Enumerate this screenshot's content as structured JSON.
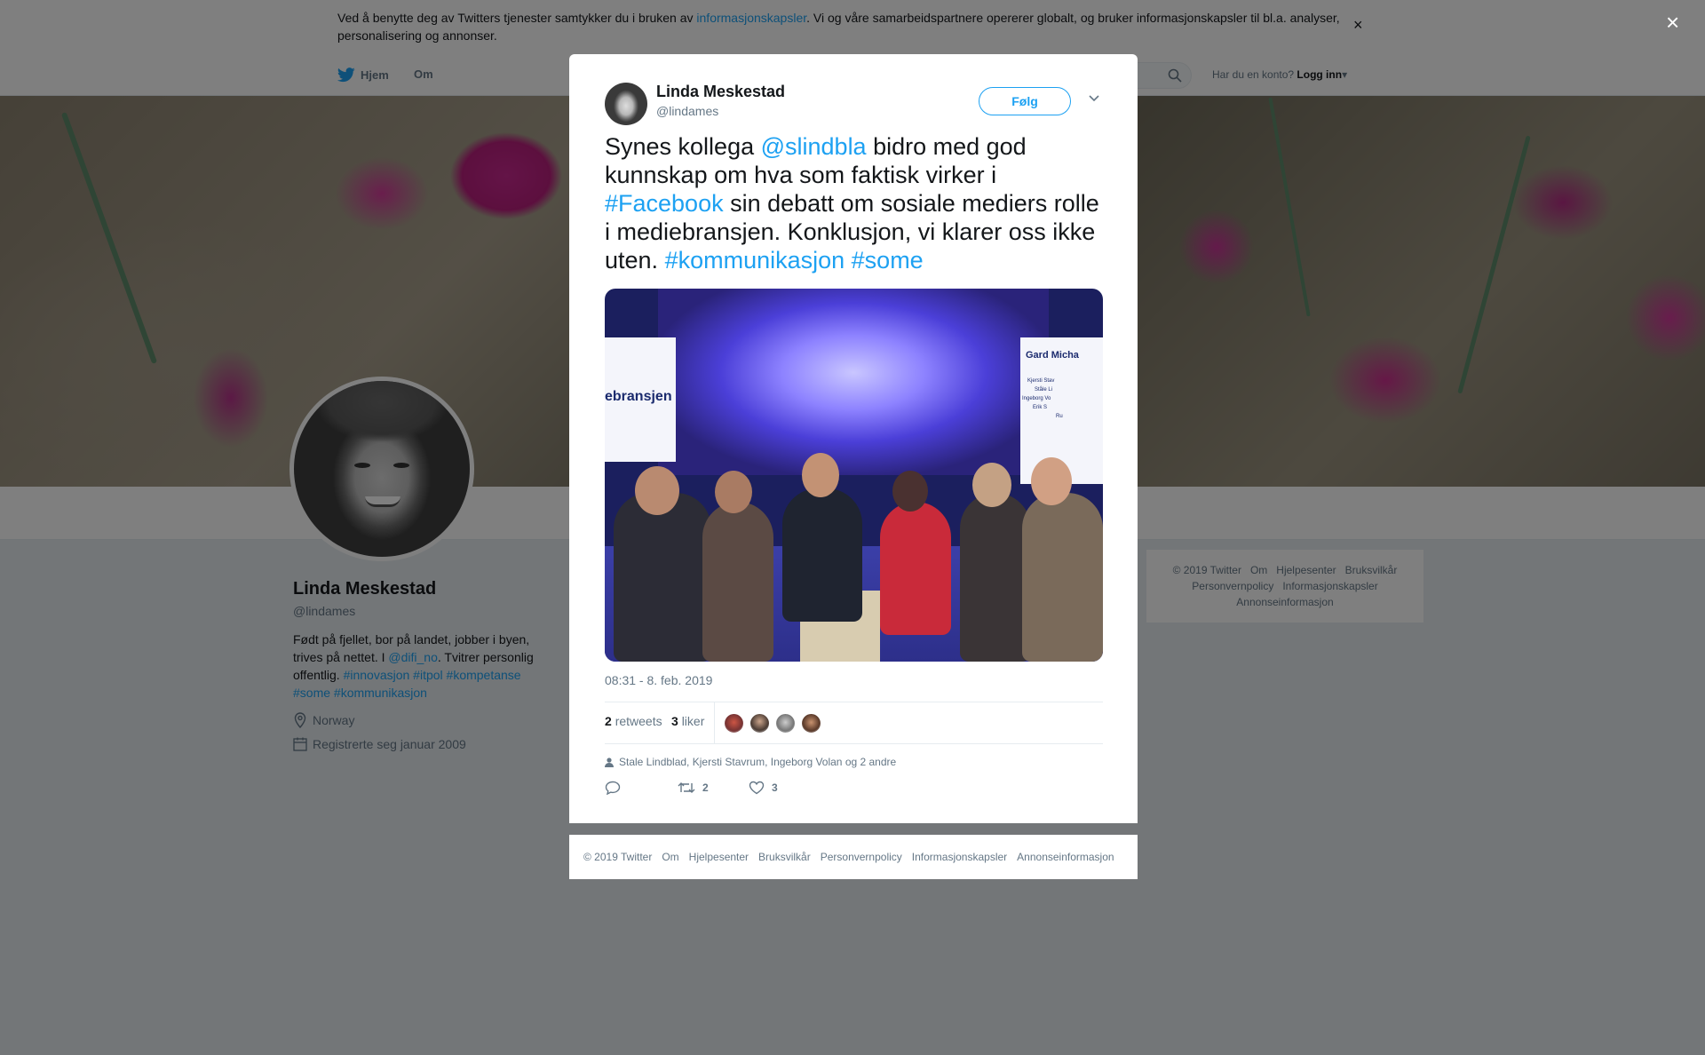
{
  "cookie": {
    "text_before": "Ved å benytte deg av Twitters tjenester samtykker du i bruken av ",
    "link": "informasjonskapsler",
    "text_after": ". Vi og våre samarbeidspartnere opererer globalt, og bruker informasjonskapsler til bl.a. analyser, personalisering og annonser.",
    "close": "×"
  },
  "topnav": {
    "home": "Hjem",
    "about": "Om",
    "account_prompt": "Har du en konto?",
    "login": "Logg inn"
  },
  "profile": {
    "name": "Linda Meskestad",
    "handle": "@lindames",
    "bio_1": "Født på fjellet, bor på landet, jobber i byen, trives på nettet. I ",
    "bio_mention": "@difi_no",
    "bio_2": ". Tvitrer personlig offentlig. ",
    "bio_tags": "#innovasjon #itpol #kompetanse #some #kommunikasjon",
    "location": "Norway",
    "joined": "Registrerte seg januar 2009"
  },
  "side_footer": {
    "items": [
      "© 2019 Twitter",
      "Om",
      "Hjelpesenter",
      "Bruksvilkår",
      "Personvernpolicy",
      "Informasjonskapsler",
      "Annonseinformasjon"
    ]
  },
  "modal": {
    "close": "×",
    "author_name": "Linda Meskestad",
    "author_handle": "@lindames",
    "follow": "Følg",
    "text_1": "Synes kollega ",
    "mention": "@slindbla",
    "text_2": " bidro med god kunnskap om hva som faktisk virker i ",
    "hashtag_facebook": "#Facebook",
    "text_3": " sin debatt om sosiale mediers rolle i mediebransjen. Konklusjon, vi klarer oss ikke uten. ",
    "hashtags_end": "#kommunikasjon #some",
    "photo": {
      "left_screen": "ebransjen",
      "right_title": "Gard Micha",
      "right_lines": [
        "Kjersti Stav",
        "Ståle Li",
        "Ingeborg Vo",
        "Erik S",
        "Ru"
      ]
    },
    "timestamp": "08:31 - 8. feb. 2019",
    "retweets_count": "2",
    "retweets_label": "retweets",
    "likes_count": "3",
    "likes_label": "liker",
    "likers_text": "Stale Lindblad, Kjersti Stavrum, Ingeborg Volan og 2 andre",
    "action_retweet_count": "2",
    "action_like_count": "3"
  },
  "modal_footer": {
    "items": [
      "© 2019 Twitter",
      "Om",
      "Hjelpesenter",
      "Bruksvilkår",
      "Personvernpolicy",
      "Informasjonskapsler",
      "Annonseinformasjon"
    ]
  },
  "colors": {
    "accent": "#1da1f2",
    "text": "#14171a",
    "muted": "#657786",
    "overlay": "rgba(0,0,0,0.5)"
  }
}
